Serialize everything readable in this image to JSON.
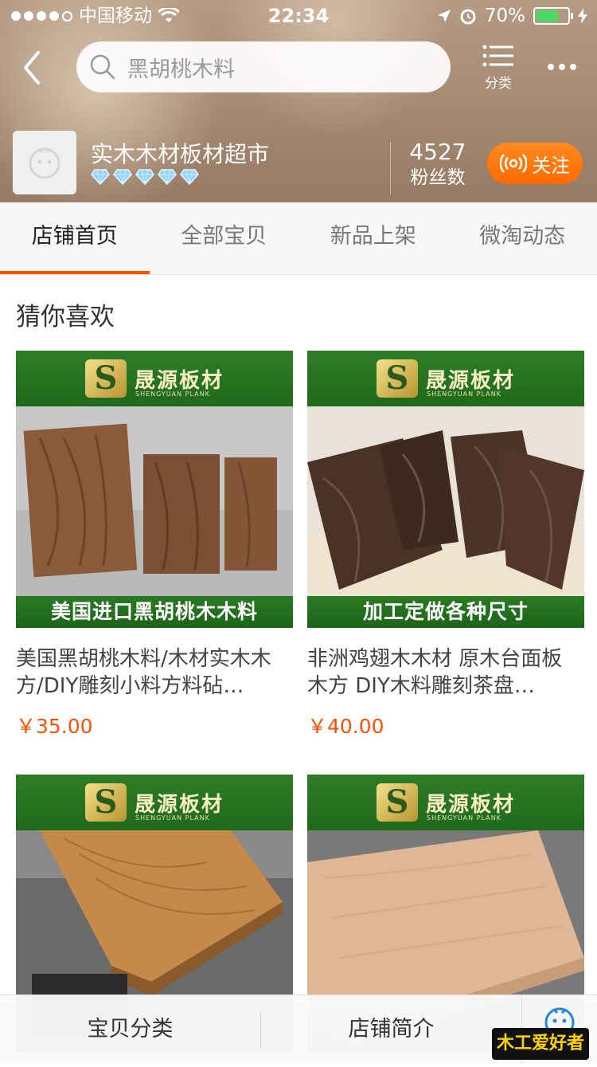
{
  "status_bar": {
    "carrier": "中国移动",
    "time": "22:34",
    "battery": "70%",
    "battery_level": 0.7
  },
  "header": {
    "search_placeholder": "黑胡桃木料",
    "category_label": "分类"
  },
  "shop": {
    "name": "实木木材板材超市",
    "diamond_count": 5,
    "fans_count": "4527",
    "fans_label": "粉丝数",
    "follow_label": "关注"
  },
  "tabs": [
    {
      "label": "店铺首页",
      "active": true
    },
    {
      "label": "全部宝贝",
      "active": false
    },
    {
      "label": "新品上架",
      "active": false
    },
    {
      "label": "微淘动态",
      "active": false
    }
  ],
  "section_title": "猜你喜欢",
  "products": [
    {
      "brand": "晟源板材",
      "brand_sub": "SHENGYUAN PLANK",
      "image_caption": "美国进口黑胡桃木木料",
      "title": "美国黑胡桃木料/木材实木木方/DIY雕刻小料方料砧…",
      "price": "￥35.00"
    },
    {
      "brand": "晟源板材",
      "brand_sub": "SHENGYUAN PLANK",
      "image_caption": "加工定做各种尺寸",
      "title": "非洲鸡翅木木材 原木台面板 木方 DIY木料雕刻茶盘…",
      "price": "￥40.00"
    },
    {
      "brand": "晟源板材",
      "brand_sub": "SHENGYUAN PLANK",
      "image_caption": "",
      "title": "",
      "price": ""
    },
    {
      "brand": "晟源板材",
      "brand_sub": "SHENGYUAN PLANK",
      "image_caption": "",
      "title": "",
      "price": ""
    }
  ],
  "bottom_bar": {
    "categories_label": "宝贝分类",
    "intro_label": "店铺简介"
  },
  "watermark": "木工爱好者",
  "colors": {
    "accent": "#ff5000",
    "follow": "#ff6a00",
    "brand_green": "#1f6a1b"
  }
}
